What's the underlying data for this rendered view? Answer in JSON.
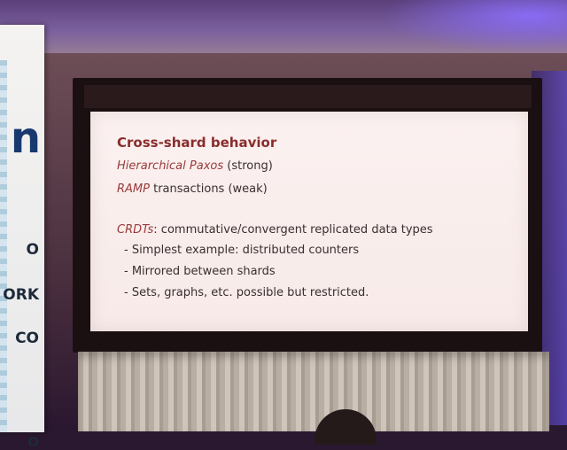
{
  "scene": {
    "banner": {
      "partial_texts": [
        "n",
        "O",
        "ORK",
        "CO",
        "O"
      ]
    },
    "slide": {
      "title": "Cross-shard behavior",
      "lines": [
        {
          "em": "Hierarchical Paxos",
          "rest": " (strong)"
        },
        {
          "em": "RAMP",
          "rest": " transactions (weak)"
        },
        {
          "em": "CRDTs",
          "rest": ": commutative/convergent replicated data types"
        }
      ],
      "bullets": [
        "- Simplest example: distributed counters",
        "- Mirrored between shards",
        "- Sets, graphs, etc. possible but restricted."
      ]
    }
  }
}
